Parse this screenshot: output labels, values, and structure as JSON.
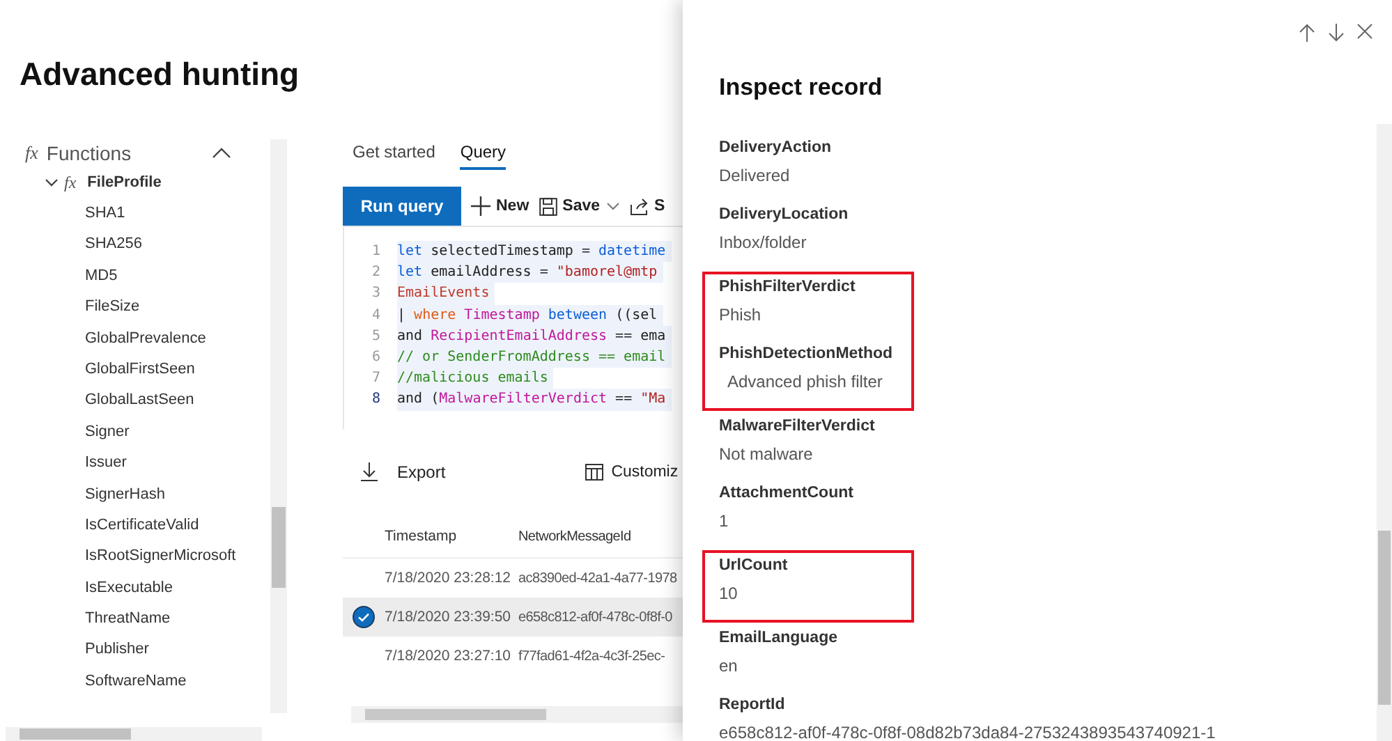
{
  "page": {
    "title": "Advanced hunting"
  },
  "sidebar": {
    "items": [
      {
        "icon": "fx",
        "label": "Functions",
        "expanded": true,
        "children": [
          {
            "icon": "fx",
            "label": "FileProfile",
            "expanded": true,
            "children": [
              {
                "label": "SHA1"
              },
              {
                "label": "SHA256"
              },
              {
                "label": "MD5"
              },
              {
                "label": "FileSize"
              },
              {
                "label": "GlobalPrevalence"
              },
              {
                "label": "GlobalFirstSeen"
              },
              {
                "label": "GlobalLastSeen"
              },
              {
                "label": "Signer"
              },
              {
                "label": "Issuer"
              },
              {
                "label": "SignerHash"
              },
              {
                "label": "IsCertificateValid"
              },
              {
                "label": "IsRootSignerMicrosoft"
              },
              {
                "label": "IsExecutable"
              },
              {
                "label": "ThreatName"
              },
              {
                "label": "Publisher"
              },
              {
                "label": "SoftwareName"
              }
            ]
          }
        ]
      }
    ]
  },
  "tabs": [
    {
      "label": "Get started",
      "selected": false
    },
    {
      "label": "Query",
      "selected": true
    }
  ],
  "toolbar": {
    "run": "Run query",
    "buttons": [
      {
        "kind": "new",
        "label": "New"
      },
      {
        "kind": "save",
        "label": "Save"
      },
      {
        "kind": "share",
        "label": "S"
      }
    ]
  },
  "editor": {
    "lines": [
      {
        "number": "1",
        "current": false,
        "tokens": [
          {
            "kind": "keyword",
            "text": "let"
          },
          {
            "kind": "plain",
            "text": " selectedTimestamp = "
          },
          {
            "kind": "keyword",
            "text": "datetime"
          }
        ]
      },
      {
        "number": "2",
        "current": false,
        "tokens": [
          {
            "kind": "keyword",
            "text": "let"
          },
          {
            "kind": "plain",
            "text": " emailAddress = "
          },
          {
            "kind": "string",
            "text": "\"bamorel@mtp"
          }
        ]
      },
      {
        "number": "3",
        "current": false,
        "tokens": [
          {
            "kind": "table",
            "text": "EmailEvents"
          }
        ]
      },
      {
        "number": "4",
        "current": false,
        "tokens": [
          {
            "kind": "plain",
            "text": "| "
          },
          {
            "kind": "operator",
            "text": "where "
          },
          {
            "kind": "column",
            "text": "Timestamp "
          },
          {
            "kind": "keyword",
            "text": "between"
          },
          {
            "kind": "plain",
            "text": " ((sel"
          }
        ]
      },
      {
        "number": "5",
        "current": false,
        "tokens": [
          {
            "kind": "plain",
            "text": "and "
          },
          {
            "kind": "column",
            "text": "RecipientEmailAddress"
          },
          {
            "kind": "plain",
            "text": " == ema"
          }
        ]
      },
      {
        "number": "6",
        "current": false,
        "tokens": [
          {
            "kind": "comment",
            "text": "// or SenderFromAddress == email"
          }
        ]
      },
      {
        "number": "7",
        "current": false,
        "tokens": [
          {
            "kind": "comment",
            "text": "//malicious emails"
          }
        ]
      },
      {
        "number": "8",
        "current": true,
        "tokens": [
          {
            "kind": "plain",
            "text": "and ("
          },
          {
            "kind": "column",
            "text": "MalwareFilterVerdict"
          },
          {
            "kind": "plain",
            "text": " == "
          },
          {
            "kind": "string",
            "text": "\"Ma"
          }
        ]
      }
    ]
  },
  "results": {
    "export": "Export",
    "customize": "Customiz",
    "columns": [
      "Timestamp",
      "NetworkMessageId"
    ],
    "rows": [
      {
        "selected": false,
        "cells": [
          "7/18/2020 23:28:12",
          "ac8390ed-42a1-4a77-1978"
        ]
      },
      {
        "selected": true,
        "cells": [
          "7/18/2020 23:39:50",
          "e658c812-af0f-478c-0f8f-0"
        ]
      },
      {
        "selected": false,
        "cells": [
          "7/18/2020 23:27:10",
          "f77fad61-4f2a-4c3f-25ec-"
        ]
      }
    ]
  },
  "panel": {
    "title": "Inspect record",
    "groups": [
      {
        "highlighted": false,
        "fields": [
          {
            "name": "DeliveryAction",
            "value": "Delivered"
          },
          {
            "name": "DeliveryLocation",
            "value": "Inbox/folder"
          }
        ]
      },
      {
        "highlighted": true,
        "fields": [
          {
            "name": "PhishFilterVerdict",
            "value": "Phish"
          },
          {
            "name": "PhishDetectionMethod",
            "value": "  Advanced phish filter"
          }
        ]
      },
      {
        "highlighted": false,
        "fields": [
          {
            "name": "MalwareFilterVerdict",
            "value": "Not malware"
          },
          {
            "name": "AttachmentCount",
            "value": "1"
          }
        ]
      },
      {
        "highlighted": true,
        "fields": [
          {
            "name": "UrlCount",
            "value": "10"
          }
        ]
      },
      {
        "highlighted": false,
        "fields": [
          {
            "name": "EmailLanguage",
            "value": "en"
          },
          {
            "name": "ReportId",
            "value": "e658c812-af0f-478c-0f8f-08d82b73da84-2753243893543740921-1"
          }
        ]
      }
    ]
  }
}
